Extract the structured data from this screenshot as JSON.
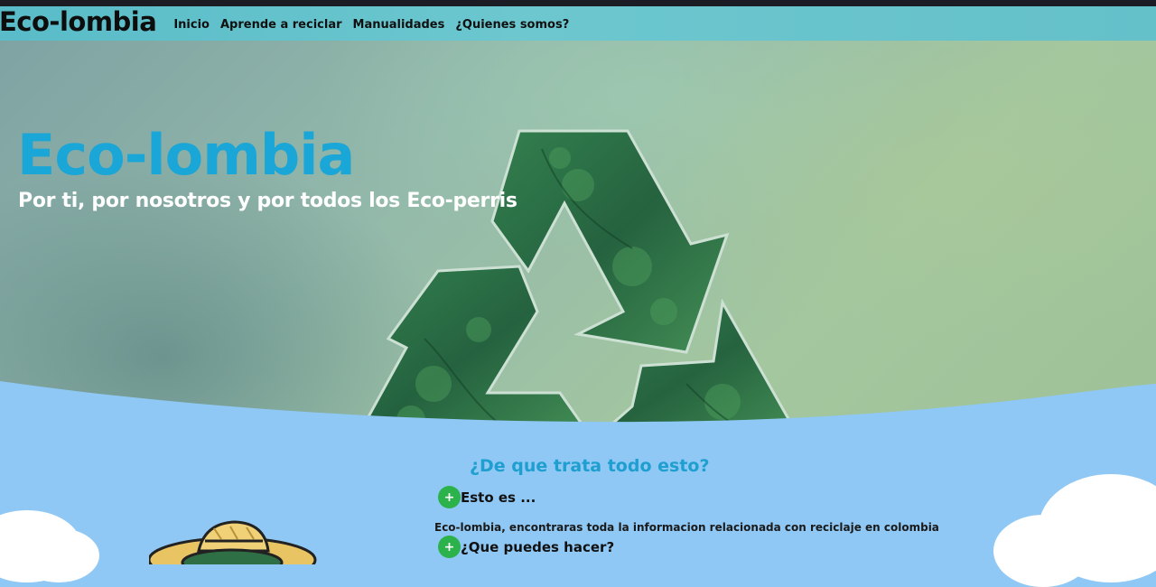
{
  "navbar": {
    "brand": "Eco-lombia",
    "links": [
      {
        "label": "Inicio"
      },
      {
        "label": "Aprende a reciclar"
      },
      {
        "label": "Manualidades"
      },
      {
        "label": "¿Quienes somos?"
      }
    ]
  },
  "hero": {
    "title": "Eco-lombia",
    "subtitle": "Por ti, por nosotros y por todos los Eco-perris"
  },
  "about": {
    "title": "¿De que trata todo esto?",
    "items": [
      {
        "label": "Esto es ...",
        "answer": "Eco-lombia, encontraras toda la informacion relacionada con reciclaje en colombia",
        "expanded": true
      },
      {
        "label": "¿Que puedes hacer?",
        "expanded": false
      }
    ]
  },
  "colors": {
    "navbar": "#64c0c9",
    "hero_title": "#1aa6d6",
    "section_bg": "#8fc8f4",
    "section_title": "#1e9fcf",
    "plus_icon": "#2bb24a"
  },
  "icons": [
    "recycle-symbol-icon",
    "plus-icon",
    "cloud-icon",
    "mascot-hat-icon"
  ]
}
